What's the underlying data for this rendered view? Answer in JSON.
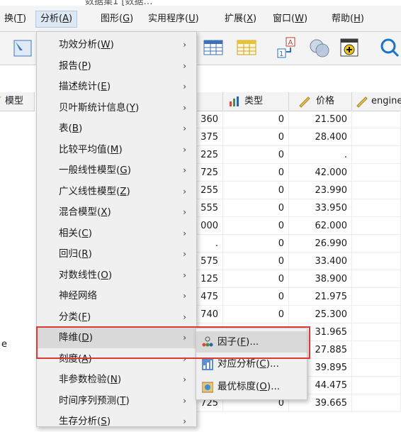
{
  "window": {
    "title_fragment": "数据集1 [数据…"
  },
  "menubar": [
    {
      "label": "换",
      "key": "T"
    },
    {
      "label": "分析",
      "key": "A"
    },
    {
      "label": "图形",
      "key": "G"
    },
    {
      "label": "实用程序",
      "key": "U"
    },
    {
      "label": "扩展",
      "key": "X"
    },
    {
      "label": "窗口",
      "key": "W"
    },
    {
      "label": "帮助",
      "key": "H"
    }
  ],
  "columns": {
    "left": "模型",
    "partial": "",
    "type": "类型",
    "price": "价格",
    "engine": "engine"
  },
  "rows": [
    {
      "p": "360",
      "t": "0",
      "v": "21.500"
    },
    {
      "p": "375",
      "t": "0",
      "v": "28.400"
    },
    {
      "p": "225",
      "t": "0",
      "v": "."
    },
    {
      "p": "725",
      "t": "0",
      "v": "42.000"
    },
    {
      "p": "255",
      "t": "0",
      "v": "23.990"
    },
    {
      "p": "555",
      "t": "0",
      "v": "33.950"
    },
    {
      "p": "000",
      "t": "0",
      "v": "62.000"
    },
    {
      "p": ".",
      "t": "0",
      "v": "26.990"
    },
    {
      "p": "575",
      "t": "0",
      "v": "33.400"
    },
    {
      "p": "125",
      "t": "0",
      "v": "38.900"
    },
    {
      "p": "475",
      "t": "0",
      "v": "21.975"
    },
    {
      "p": "740",
      "t": "0",
      "v": "25.300"
    },
    {
      "p": "",
      "t": "",
      "v": "31.965"
    },
    {
      "p": "",
      "t": "",
      "v": "27.885"
    },
    {
      "p": "",
      "t": "",
      "v": "39.895"
    },
    {
      "p": "",
      "t": "",
      "v": "44.475"
    },
    {
      "p": "725",
      "t": "0",
      "v": "39.665"
    }
  ],
  "left_col_fragments": {
    "row13": "e"
  },
  "analyze_menu": [
    {
      "label": "功效分析",
      "key": "W"
    },
    {
      "label": "报告",
      "key": "P"
    },
    {
      "label": "描述统计",
      "key": "E"
    },
    {
      "label": "贝叶斯统计信息",
      "key": "Y"
    },
    {
      "label": "表",
      "key": "B"
    },
    {
      "label": "比较平均值",
      "key": "M"
    },
    {
      "label": "一般线性模型",
      "key": "G"
    },
    {
      "label": "广义线性模型",
      "key": "Z"
    },
    {
      "label": "混合模型",
      "key": "X"
    },
    {
      "label": "相关",
      "key": "C"
    },
    {
      "label": "回归",
      "key": "R"
    },
    {
      "label": "对数线性",
      "key": "O"
    },
    {
      "label": "神经网络",
      "key": ""
    },
    {
      "label": "分类",
      "key": "F"
    },
    {
      "label": "降维",
      "key": "D"
    },
    {
      "label": "刻度",
      "key": "A"
    },
    {
      "label": "非参数检验",
      "key": "N"
    },
    {
      "label": "时间序列预测",
      "key": "T"
    },
    {
      "label": "生存分析",
      "key": "S"
    }
  ],
  "submenu": [
    {
      "label": "因子",
      "key": "F",
      "suffix": "...",
      "icon": "factor-icon"
    },
    {
      "label": "对应分析",
      "key": "C",
      "suffix": "...",
      "icon": "correspondence-icon"
    },
    {
      "label": "最优标度",
      "key": "O",
      "suffix": "...",
      "icon": "optimal-scaling-icon"
    }
  ],
  "colors": {
    "highlight_border": "#d93a33",
    "menu_bg": "#f0f0f0",
    "menu_hover": "#d9d9d9"
  }
}
